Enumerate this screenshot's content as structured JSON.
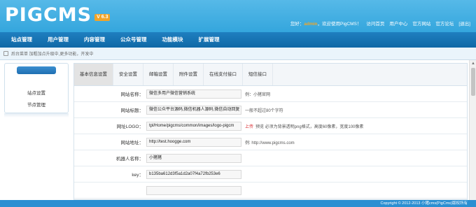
{
  "brand": {
    "logo": "PIGCMS",
    "version": "V 6.3"
  },
  "userbar": {
    "greeting_prefix": "您好：",
    "username": "admin",
    "greeting_suffix": "，欢迎使用PigCMS！",
    "links": [
      "访问首页",
      "用户中心",
      "官方网站",
      "官方论坛",
      "[退出]"
    ]
  },
  "nav": {
    "items": [
      "站点管理",
      "用户管理",
      "内容管理",
      "公众号管理",
      "功能模块",
      "扩展管理"
    ]
  },
  "breadcrumb": {
    "text": "后台菜单  加粗加点升级中,更多功能，开发中"
  },
  "sidebar": {
    "items": [
      "站点设置",
      "节点管理"
    ]
  },
  "tabs": [
    "基本信息设置",
    "安全设置",
    "邮箱设置",
    "附件设置",
    "在线支付接口",
    "短信接口"
  ],
  "form": {
    "rows": [
      {
        "label": "网站名称：",
        "value": "微信多用户微信营销系统",
        "hint": "例：小猪官网"
      },
      {
        "label": "网站标题：",
        "value": "微信公众平台源码,微信机器人源码,微信自动回复",
        "hint": "一般不超过80个字符"
      },
      {
        "label": "网址LOGO：",
        "value": "tpl/Home/pigcms/common/images/logo-pigcm",
        "upload": "上传",
        "hint": "预览  必须为背景透明png格式，高度60像素，宽度100像素"
      },
      {
        "label": "网站地址：",
        "value": "http://test.hoogge.com",
        "hint": "例: http://www.pigcms.com"
      },
      {
        "label": "机器人名称：",
        "value": "小猪猪",
        "hint": ""
      },
      {
        "label": "key：",
        "value": "b135ba612d3f5a1d2a07f4a72fb253e6",
        "hint": ""
      }
    ]
  },
  "footer": {
    "text": "Copyright © 2012-2013 小猪cms(PigCms)版权所有"
  }
}
